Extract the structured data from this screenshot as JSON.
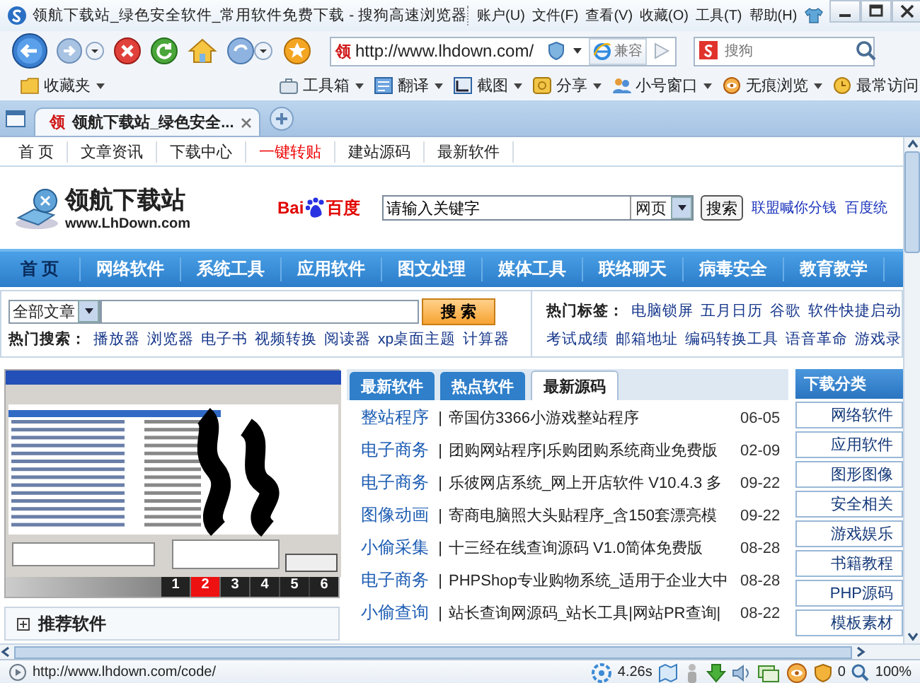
{
  "window": {
    "title": "领航下载站_绿色安全软件_常用软件免费下载 - 搜狗高速浏览器",
    "menu": [
      "账户(U)",
      "文件(F)",
      "查看(V)",
      "收藏(O)",
      "工具(T)",
      "帮助(H)"
    ]
  },
  "toolbar": {
    "site_badge": "领",
    "address": "http://www.lhdown.com/",
    "compat_label": "兼容",
    "search_placeholder": "搜狗"
  },
  "favorites_bar": [
    {
      "label": "收藏夹"
    },
    {
      "label": "工具箱"
    },
    {
      "label": "翻译"
    },
    {
      "label": "截图"
    },
    {
      "label": "分享"
    },
    {
      "label": "小号窗口"
    },
    {
      "label": "无痕浏览"
    },
    {
      "label": "最常访问"
    }
  ],
  "tabs": [
    {
      "badge": "领",
      "label": "领航下载站_绿色安全...",
      "selected": true
    }
  ],
  "page": {
    "top_links": [
      {
        "label": "首 页",
        "hot": false
      },
      {
        "label": "文章资讯",
        "hot": false
      },
      {
        "label": "下载中心",
        "hot": false
      },
      {
        "label": "一键转贴",
        "hot": true
      },
      {
        "label": "建站源码",
        "hot": false
      },
      {
        "label": "最新软件",
        "hot": false
      }
    ],
    "logo": {
      "title": "领航下载站",
      "url": "www.LhDown.com"
    },
    "baidu": {
      "logo_left": "Bai",
      "logo_right": "百度",
      "value": "请输入关键字",
      "scope": "网页",
      "button": "搜索",
      "links": [
        "联盟喊你分钱",
        "百度统"
      ]
    },
    "nav": [
      {
        "label": "首 页",
        "selected": true
      },
      {
        "label": "网络软件",
        "selected": false
      },
      {
        "label": "系统工具",
        "selected": false
      },
      {
        "label": "应用软件",
        "selected": false
      },
      {
        "label": "图文处理",
        "selected": false
      },
      {
        "label": "媒体工具",
        "selected": false
      },
      {
        "label": "联络聊天",
        "selected": false
      },
      {
        "label": "病毒安全",
        "selected": false
      },
      {
        "label": "教育教学",
        "selected": false
      }
    ],
    "site_search": {
      "scope": "全部文章",
      "button": "搜 索",
      "hot_label": "热门搜索：",
      "hot_terms": [
        "播放器",
        "浏览器",
        "电子书",
        "视频转换",
        "阅读器",
        "xp桌面主题",
        "计算器"
      ],
      "tags_label": "热门标签：",
      "tags": [
        "电脑锁屏",
        "五月日历",
        "谷歌",
        "软件快捷启动",
        "考试成绩",
        "邮箱地址",
        "编码转换工具",
        "语音革命",
        "游戏录"
      ]
    },
    "slideshow": {
      "pages": [
        {
          "label": "1",
          "selected": false
        },
        {
          "label": "2",
          "selected": true
        },
        {
          "label": "3",
          "selected": false
        },
        {
          "label": "4",
          "selected": false
        },
        {
          "label": "5",
          "selected": false
        },
        {
          "label": "6",
          "selected": false
        }
      ]
    },
    "recommend": {
      "title": "推荐软件"
    },
    "news_tabs": [
      {
        "label": "最新软件",
        "selected": false
      },
      {
        "label": "热点软件",
        "selected": false
      },
      {
        "label": "最新源码",
        "selected": true
      }
    ],
    "news": [
      {
        "category": "整站程序",
        "separator": "|",
        "title": "帝国仿3366小游戏整站程序",
        "date": "06-05"
      },
      {
        "category": "电子商务",
        "separator": "|",
        "title": "团购网站程序|乐购团购系统商业免费版",
        "date": "02-09"
      },
      {
        "category": "电子商务",
        "separator": "|",
        "title": "乐彼网店系统_网上开店软件 V10.4.3 多",
        "date": "09-22"
      },
      {
        "category": "图像动画",
        "separator": "|",
        "title": "寄商电脑照大头贴程序_含150套漂亮模",
        "date": "09-22"
      },
      {
        "category": "小偷采集",
        "separator": "|",
        "title": "十三经在线查询源码 V1.0简体免费版",
        "date": "08-28"
      },
      {
        "category": "电子商务",
        "separator": "|",
        "title": "PHPShop专业购物系统_适用于企业大中",
        "date": "08-28"
      },
      {
        "category": "小偷查询",
        "separator": "|",
        "title": "站长查询网源码_站长工具|网站PR查询|",
        "date": "08-22"
      }
    ],
    "sidebar": {
      "title": "下载分类",
      "items": [
        "网络软件",
        "应用软件",
        "图形图像",
        "安全相关",
        "游戏娱乐",
        "书籍教程",
        "PHP源码",
        "模板素材"
      ]
    }
  },
  "status_bar": {
    "url": "http://www.lhdown.com/code/",
    "load_time": "4.26s",
    "blocked_count": "0",
    "zoom": "100%"
  }
}
